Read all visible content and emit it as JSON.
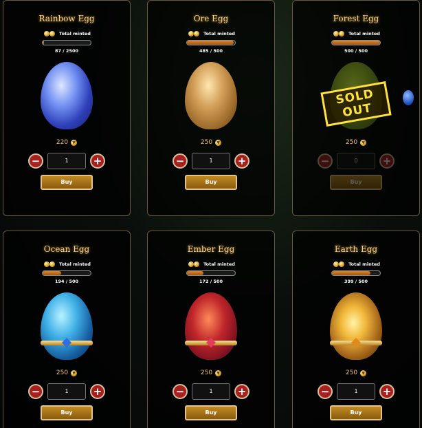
{
  "currency_icon": "coin-icon",
  "eggs": [
    {
      "title": "Rainbow Egg",
      "minted_label": "Total minted",
      "minted": "87",
      "supply": "2500",
      "progress": 0.035,
      "price": "220",
      "qty": "1",
      "buy_label": "Buy",
      "sold_out": false
    },
    {
      "title": "Ore Egg",
      "minted_label": "Total minted",
      "minted": "485",
      "supply": "500",
      "progress": 0.97,
      "price": "250",
      "qty": "1",
      "buy_label": "Buy",
      "sold_out": false
    },
    {
      "title": "Forest Egg",
      "minted_label": "Total minted",
      "minted": "500",
      "supply": "500",
      "progress": 1.0,
      "price": "250",
      "qty": "0",
      "buy_label": "Buy",
      "sold_out": true,
      "sold_out_label": "SOLD OUT"
    },
    {
      "title": "Ocean Egg",
      "minted_label": "Total minted",
      "minted": "194",
      "supply": "500",
      "progress": 0.388,
      "price": "250",
      "qty": "1",
      "buy_label": "Buy",
      "sold_out": false
    },
    {
      "title": "Ember Egg",
      "minted_label": "Total minted",
      "minted": "172",
      "supply": "500",
      "progress": 0.344,
      "price": "250",
      "qty": "1",
      "buy_label": "Buy",
      "sold_out": false
    },
    {
      "title": "Earth Egg",
      "minted_label": "Total minted",
      "minted": "399",
      "supply": "500",
      "progress": 0.798,
      "price": "250",
      "qty": "1",
      "buy_label": "Buy",
      "sold_out": false
    }
  ],
  "colors": {
    "card_border": "#6b5a3a",
    "title_gold": "#f6d79a",
    "progress_fill": "#d98a2a",
    "stepper_red": "#a8201e",
    "buy_gold": "#c08a22",
    "sold_out_yellow": "#ffe33a"
  }
}
